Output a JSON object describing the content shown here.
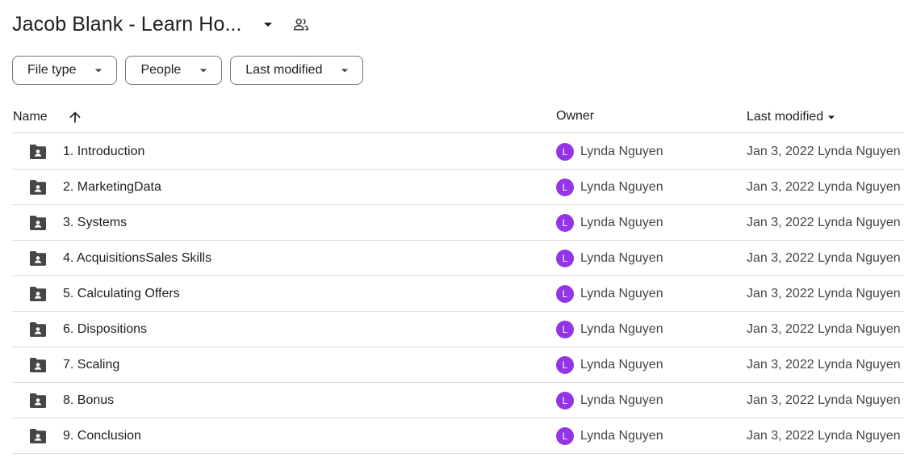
{
  "header": {
    "title": "Jacob Blank - Learn Ho...",
    "caret_icon": "arrow-drop-down-icon",
    "shared_icon": "people-outline-icon"
  },
  "filters": {
    "file_type": "File type",
    "people": "People",
    "last_modified": "Last modified"
  },
  "columns": {
    "name": "Name",
    "owner": "Owner",
    "last_modified": "Last modified"
  },
  "rows": [
    {
      "name": "1. Introduction",
      "avatar": "L",
      "owner": "Lynda Nguyen",
      "modified": "Jan 3, 2022 Lynda Nguyen"
    },
    {
      "name": "2. MarketingData",
      "avatar": "L",
      "owner": "Lynda Nguyen",
      "modified": "Jan 3, 2022 Lynda Nguyen"
    },
    {
      "name": "3. Systems",
      "avatar": "L",
      "owner": "Lynda Nguyen",
      "modified": "Jan 3, 2022 Lynda Nguyen"
    },
    {
      "name": "4. AcquisitionsSales Skills",
      "avatar": "L",
      "owner": "Lynda Nguyen",
      "modified": "Jan 3, 2022 Lynda Nguyen"
    },
    {
      "name": "5. Calculating Offers",
      "avatar": "L",
      "owner": "Lynda Nguyen",
      "modified": "Jan 3, 2022 Lynda Nguyen"
    },
    {
      "name": "6. Dispositions",
      "avatar": "L",
      "owner": "Lynda Nguyen",
      "modified": "Jan 3, 2022 Lynda Nguyen"
    },
    {
      "name": "7. Scaling",
      "avatar": "L",
      "owner": "Lynda Nguyen",
      "modified": "Jan 3, 2022 Lynda Nguyen"
    },
    {
      "name": "8. Bonus",
      "avatar": "L",
      "owner": "Lynda Nguyen",
      "modified": "Jan 3, 2022 Lynda Nguyen"
    },
    {
      "name": "9. Conclusion",
      "avatar": "L",
      "owner": "Lynda Nguyen",
      "modified": "Jan 3, 2022 Lynda Nguyen"
    }
  ],
  "colors": {
    "avatar": "#9334e6",
    "folder_icon": "#444746",
    "divider": "#dadce0"
  }
}
